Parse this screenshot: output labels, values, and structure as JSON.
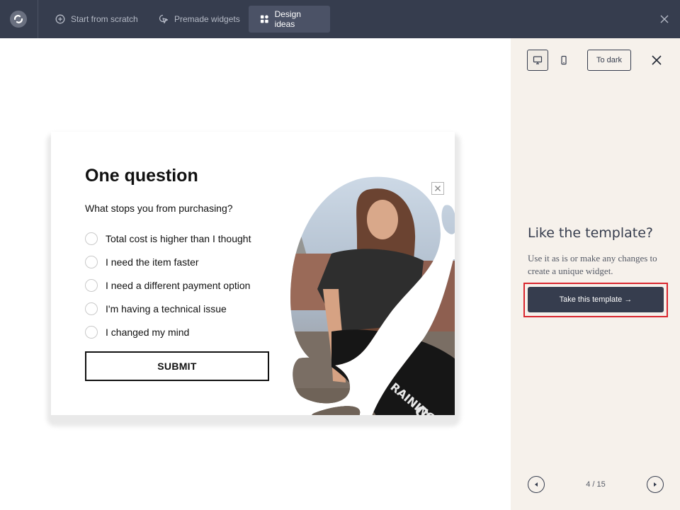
{
  "topbar": {
    "tabs": [
      {
        "label": "Start from scratch",
        "icon": "plus-circle-icon"
      },
      {
        "label": "Premade widgets",
        "icon": "cursor-click-icon"
      },
      {
        "label": "Design ideas",
        "icon": "grid-shapes-icon",
        "active": true
      }
    ]
  },
  "widget": {
    "title": "One question",
    "question": "What stops you from purchasing?",
    "options": [
      "Total cost is higher than I thought",
      "I need the item faster",
      "I need a different payment option",
      "I'm having a technical issue",
      "I changed my mind"
    ],
    "submit_label": "SUBMIT"
  },
  "panel": {
    "to_dark_label": "To dark",
    "like_title": "Like the template?",
    "like_desc": "Use it as is or make any changes to create a unique widget.",
    "take_label": "Take this template →",
    "counter": "4 / 15"
  },
  "colors": {
    "topbar_bg": "#363d4e",
    "panel_bg": "#f6f1eb",
    "accent_dark": "#363d4e",
    "highlight": "#d9262e"
  }
}
